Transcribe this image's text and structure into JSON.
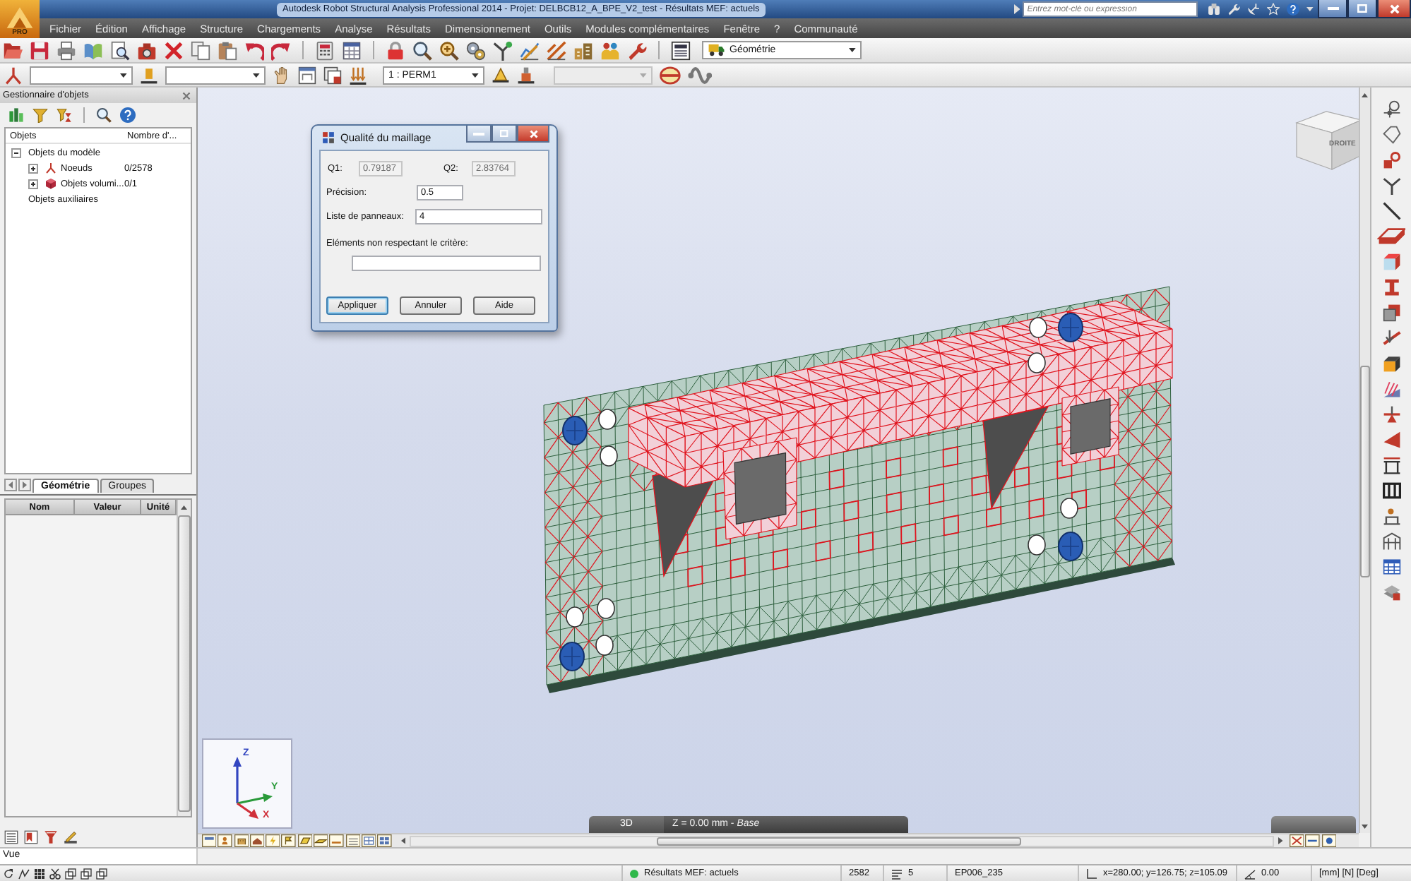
{
  "window": {
    "title": "Autodesk Robot Structural Analysis Professional 2014 - Projet: DELBCB12_A_BPE_V2_test - Résultats MEF: actuels",
    "logo": "PRO",
    "search": {
      "placeholder": "Entrez mot-clé ou expression"
    }
  },
  "menu": [
    "Fichier",
    "Édition",
    "Affichage",
    "Structure",
    "Chargements",
    "Analyse",
    "Résultats",
    "Dimensionnement",
    "Outils",
    "Modules complémentaires",
    "Fenêtre",
    "?",
    "Communauté"
  ],
  "toolbar": {
    "layout": {
      "value": "Géométrie"
    }
  },
  "selection_bar": {
    "dropdowns": [
      {
        "disabled": false
      },
      {
        "disabled": false
      },
      {
        "value": "1 : PERM1",
        "disabled": false
      },
      {
        "disabled": true
      }
    ]
  },
  "object_manager": {
    "title": "Gestionnaire d'objets",
    "columns": [
      "Objets",
      "Nombre d'..."
    ],
    "tree": [
      {
        "label": "Objets du modèle",
        "expanded": true,
        "children": [
          {
            "label": "Noeuds",
            "count": "0/2578",
            "expanded": false,
            "kind": "node"
          },
          {
            "label": "Objets volumi...",
            "count": "0/1",
            "expanded": false,
            "kind": "solid"
          }
        ]
      },
      {
        "label": "Objets auxiliaires"
      }
    ],
    "tabs": [
      {
        "label": "Géométrie",
        "selected": true
      },
      {
        "label": "Groupes",
        "selected": false
      }
    ],
    "properties": {
      "columns": [
        "Nom",
        "Valeur",
        "Unité"
      ]
    }
  },
  "viewport": {
    "view_cube": {
      "label": "DROITE"
    },
    "axes": [
      {
        "label": "Z"
      },
      {
        "label": "Y"
      },
      {
        "label": "X"
      }
    ],
    "view_bar": {
      "mode": "3D",
      "plane": "Z = 0.00 mm - *Base*"
    }
  },
  "dialog": {
    "title": "Qualité du maillage",
    "readouts": [
      {
        "label": "Q1:",
        "value": "0.79187",
        "disabled": true
      },
      {
        "label": "Q2:",
        "value": "2.83764",
        "disabled": true
      }
    ],
    "fields": [
      {
        "label": "Précision:",
        "value": "0.5",
        "kind": "inline"
      },
      {
        "label": "Liste de panneaux:",
        "value": "4",
        "kind": "inline"
      },
      {
        "label": "Eléments non respectant le critère:",
        "kind": "stacked"
      }
    ],
    "buttons": [
      {
        "label": "Appliquer",
        "default": true
      },
      {
        "label": "Annuler",
        "default": false
      },
      {
        "label": "Aide",
        "default": false
      }
    ]
  },
  "context": "Vue",
  "status_bar": {
    "results": "Résultats MEF: actuels",
    "count_1": "2582",
    "count_2": "5",
    "element": "EP006_235",
    "coordinates": "x=280.00; y=126.75; z=105.09",
    "angle": "0.00",
    "units": "[mm] [N] [Deg]"
  }
}
